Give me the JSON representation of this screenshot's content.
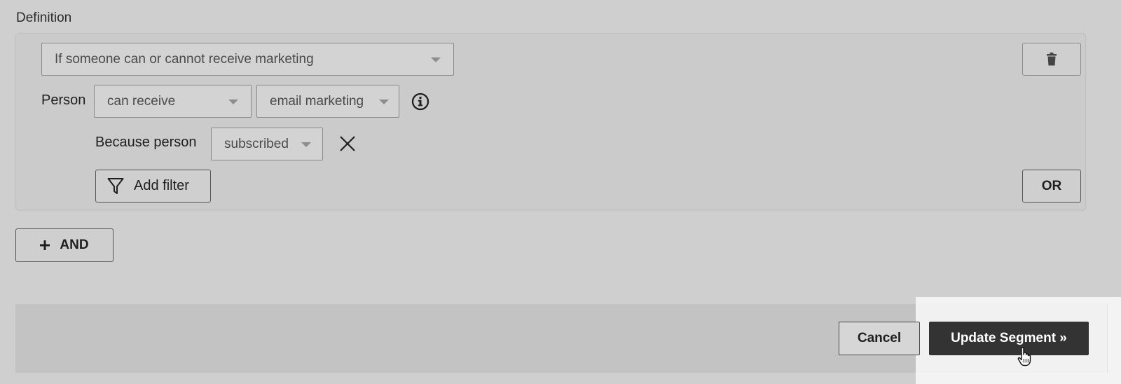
{
  "definition": {
    "label": "Definition"
  },
  "condition": {
    "type_select": "If someone can or cannot receive marketing",
    "person_label": "Person",
    "ability_select": "can receive",
    "channel_select": "email marketing",
    "because_label": "Because person",
    "reason_select": "subscribed",
    "add_filter_label": "Add filter",
    "or_label": "OR",
    "icons": {
      "delete": "trash-icon",
      "info": "info-icon",
      "remove": "close-icon",
      "filter": "filter-icon"
    }
  },
  "and_button": {
    "label": "AND",
    "icon": "plus-icon"
  },
  "footer": {
    "cancel_label": "Cancel",
    "update_label": "Update Segment »"
  }
}
